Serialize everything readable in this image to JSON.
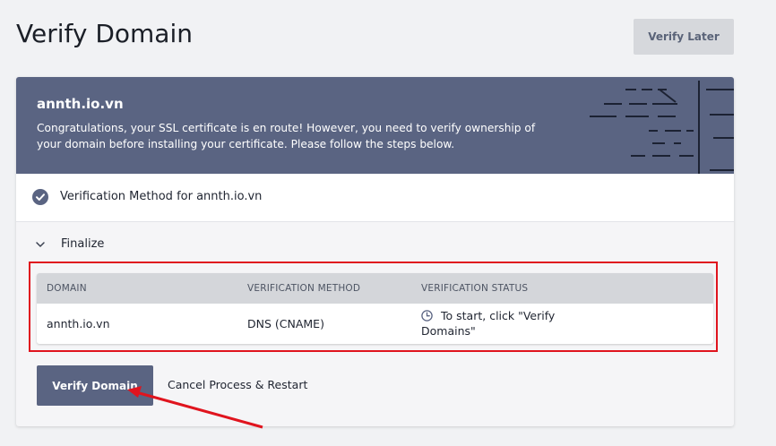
{
  "page": {
    "title": "Verify Domain",
    "verify_later_label": "Verify Later"
  },
  "banner": {
    "domain": "annth.io.vn",
    "message": "Congratulations, your SSL certificate is en route! However, you need to verify ownership of your domain before installing your certificate. Please follow the steps below."
  },
  "steps": {
    "method_label": "Verification Method for annth.io.vn",
    "finalize_label": "Finalize"
  },
  "table": {
    "headers": [
      "DOMAIN",
      "VERIFICATION METHOD",
      "VERIFICATION STATUS"
    ],
    "rows": [
      {
        "domain": "annth.io.vn",
        "method": "DNS (CNAME)",
        "status": "To start, click \"Verify Domains\""
      }
    ]
  },
  "actions": {
    "verify_domain_label": "Verify Domain",
    "cancel_label": "Cancel Process & Restart"
  },
  "icons": {
    "check": "check-circle-icon",
    "chevron": "chevron-down-icon",
    "clock": "clock-icon"
  },
  "colors": {
    "banner_bg": "#5a6482",
    "primary_button": "#5a6482",
    "highlight": "#e0141e",
    "page_bg": "#f1f2f4"
  }
}
